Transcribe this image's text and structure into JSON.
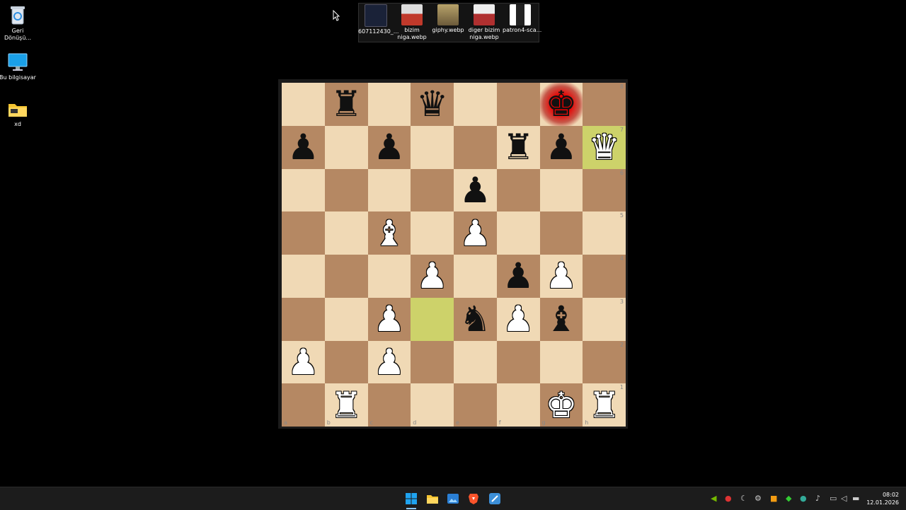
{
  "desktop_icons": [
    {
      "label": "Geri\nDönüşü...",
      "icon": "recycle-bin-icon"
    },
    {
      "label": "Bu bilgisayar",
      "icon": "computer-icon"
    },
    {
      "label": "xd",
      "icon": "folder-icon"
    }
  ],
  "files": [
    {
      "label": "607112430_...",
      "icon": "image-thumbnail"
    },
    {
      "label": "bizim\nniga.webp",
      "icon": "image-thumbnail"
    },
    {
      "label": "giphy.webp",
      "icon": "image-thumbnail"
    },
    {
      "label": "diger bizim\nniga.webp",
      "icon": "image-thumbnail"
    },
    {
      "label": "patron4-sca...",
      "icon": "image-thumbnail"
    }
  ],
  "board": {
    "ranks": [
      "8",
      "7",
      "6",
      "5",
      "4",
      "3",
      "2",
      "1"
    ],
    "files": [
      "a",
      "b",
      "c",
      "d",
      "e",
      "f",
      "g",
      "h"
    ],
    "pieces": [
      [
        "",
        "r",
        "",
        "q",
        "",
        "",
        "k",
        ""
      ],
      [
        "p",
        "",
        "p",
        "",
        "",
        "r",
        "p",
        "Q"
      ],
      [
        "",
        "",
        "",
        "",
        "p",
        "",
        "",
        ""
      ],
      [
        "",
        "",
        "B",
        "",
        "P",
        "",
        "",
        ""
      ],
      [
        "",
        "",
        "",
        "P",
        "",
        "p",
        "P",
        ""
      ],
      [
        "",
        "",
        "P",
        "",
        "n",
        "P",
        "b",
        ""
      ],
      [
        "P",
        "",
        "P",
        "",
        "",
        "",
        "",
        ""
      ],
      [
        "",
        "R",
        "",
        "",
        "",
        "",
        "K",
        "R"
      ]
    ],
    "last_move": [
      "h7",
      "d3"
    ],
    "check_square": "g8",
    "colors": {
      "light": "#f0d9b5",
      "dark": "#b58863",
      "highlight": "#cdd26a",
      "check": "#e80000"
    }
  },
  "taskbar": {
    "apps": [
      "start-icon",
      "file-explorer-icon",
      "photos-icon",
      "brave-browser-icon",
      "app-icon"
    ],
    "clock_time": "08:02",
    "clock_date": "12.01.2026"
  }
}
